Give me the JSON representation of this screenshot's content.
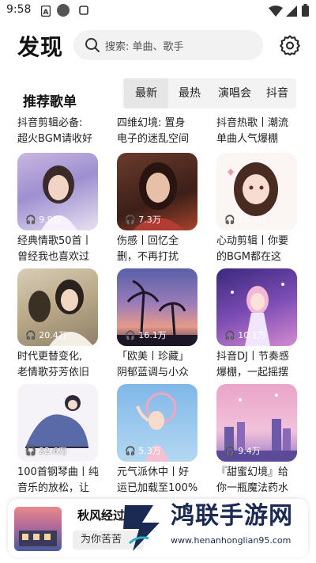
{
  "status_bar": {
    "time": "9:58"
  },
  "header": {
    "title": "发现",
    "search_placeholder": "搜索: 单曲、歌手"
  },
  "section": {
    "title": "推荐歌单"
  },
  "tabs": [
    {
      "label": "最新",
      "active": true
    },
    {
      "label": "最热",
      "active": false
    },
    {
      "label": "演唱会",
      "active": false
    },
    {
      "label": "抖音",
      "active": false
    }
  ],
  "partial_row": [
    {
      "line1": "抖音剪辑必备:",
      "line2": "超火BGM请收好"
    },
    {
      "line1": "四维幻境: 置身",
      "line2": "电子的迷乱空间"
    },
    {
      "line1": "抖音热歌丨潮流",
      "line2": "单曲人气爆棚"
    }
  ],
  "playlists": [
    {
      "plays": "9.9万",
      "line1": "经典情歌50首丨",
      "line2": "曾经我也喜欢过"
    },
    {
      "plays": "7.3万",
      "line1": "伤感丨回忆全",
      "line2": "删，不再打扰"
    },
    {
      "plays": "20.3万",
      "line1": "心动剪辑丨你要",
      "line2": "的BGM都在这"
    },
    {
      "plays": "20.4万",
      "line1": "时代更替变化,",
      "line2": "老情歌芬芳依旧"
    },
    {
      "plays": "16.1万",
      "line1": "「欧美丨珍藏」",
      "line2": "阴郁蓝调与小众"
    },
    {
      "plays": "10.1万",
      "line1": "抖音DJ丨节奏感",
      "line2": "爆棚，一起摇摆"
    },
    {
      "plays": "22.6万",
      "line1": "100首钢琴曲丨纯",
      "line2": "音乐的放松，让"
    },
    {
      "plays": "5.3万",
      "line1": "元气派休中丨好",
      "line2": "运已加载至100%"
    },
    {
      "plays": "9.4万",
      "line1": "『甜蜜幻境』给",
      "line2": "你一瓶魔法药水"
    }
  ],
  "player": {
    "song": "秋风经过",
    "artist": "为你苦苦"
  },
  "watermark": {
    "text": "鸿联手游网",
    "url": "www.henanhonglian95.com"
  },
  "colors": {
    "accent": "#111111",
    "tab_bg": "#f3f3f3",
    "search_bg": "#f2f2f2",
    "watermark": "#1b2a52"
  }
}
